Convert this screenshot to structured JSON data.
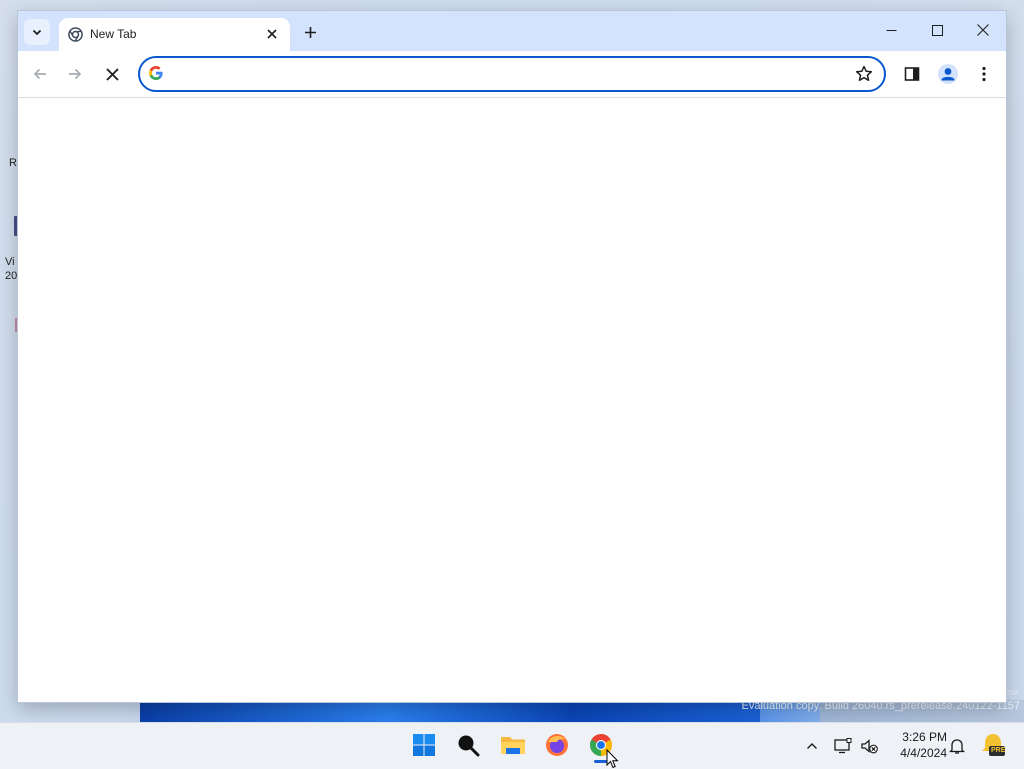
{
  "desktop": {
    "fragments": [
      "R",
      "Vi",
      "20"
    ],
    "watermark": "Evaluation copy. Build 26040.rs_prerelease.240122-1157",
    "watermark_small": "ew"
  },
  "browser": {
    "tab": {
      "title": "New Tab"
    },
    "omnibox": {
      "value": "",
      "placeholder": ""
    },
    "icons": {
      "tab_search": "chevron-down-icon",
      "favicon": "chrome-favicon",
      "close": "close-icon",
      "new_tab": "plus-icon",
      "back": "arrow-left-icon",
      "forward": "arrow-right-icon",
      "stop": "x-icon",
      "bookmark": "star-icon",
      "side_panel": "side-panel-icon",
      "profile": "person-icon",
      "menu": "kebab-icon"
    }
  },
  "taskbar": {
    "apps": [
      "start",
      "search",
      "file-explorer",
      "firefox",
      "chrome"
    ],
    "active_app": "chrome",
    "clock": {
      "time": "3:26 PM",
      "date": "4/4/2024"
    },
    "tray_icons": [
      "chevron-up-icon",
      "network-icon",
      "volume-muted-icon",
      "notification-bell-icon",
      "pre-release-badge-icon"
    ],
    "pre_badge": "PRE"
  },
  "colors": {
    "accent": "#0b57d0",
    "tabbar_bg": "#d3e3fd",
    "taskbar_bg": "#eef1f6"
  }
}
